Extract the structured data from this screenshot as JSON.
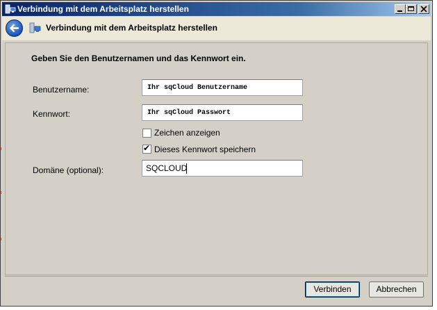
{
  "window": {
    "title": "Verbindung mit dem Arbeitsplatz herstellen"
  },
  "navbar": {
    "title": "Verbindung mit dem Arbeitsplatz herstellen"
  },
  "form": {
    "instruction": "Geben Sie den Benutzernamen und das Kennwort ein.",
    "username_label": "Benutzername:",
    "username_value": "Ihr sqCloud Benutzername",
    "password_label": "Kennwort:",
    "password_value": "Ihr sqCloud Passwort",
    "show_chars_label": "Zeichen anzeigen",
    "show_chars_checked": false,
    "save_password_label": "Dieses Kennwort speichern",
    "save_password_checked": true,
    "domain_label": "Domäne (optional):",
    "domain_value": "SQCLOUD"
  },
  "buttons": {
    "connect": "Verbinden",
    "cancel": "Abbrechen"
  },
  "icons": {
    "app": "network-computer-icon",
    "back": "back-arrow-icon",
    "minimize": "minimize-icon",
    "maximize": "maximize-icon",
    "close": "close-icon",
    "check": "✔"
  }
}
